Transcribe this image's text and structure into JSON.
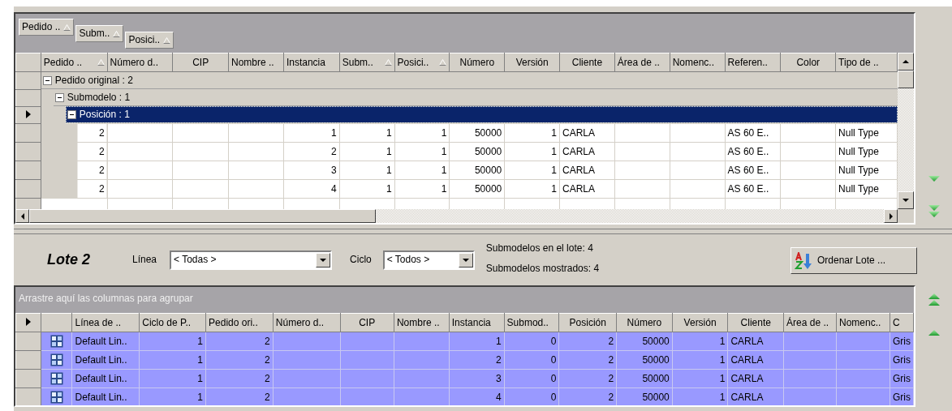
{
  "top_grid": {
    "group_by": [
      {
        "label": "Pedido ..",
        "sorted": true
      },
      {
        "label": "Subm..",
        "sorted": true
      },
      {
        "label": "Posici..",
        "sorted": true
      }
    ],
    "columns": [
      {
        "label": "Pedido ..",
        "sorted": true
      },
      {
        "label": "Número d.."
      },
      {
        "label": "CIP"
      },
      {
        "label": "Nombre .."
      },
      {
        "label": "Instancia"
      },
      {
        "label": "Subm..",
        "sorted": true
      },
      {
        "label": "Posici..",
        "sorted": true
      },
      {
        "label": "Número"
      },
      {
        "label": "Versión"
      },
      {
        "label": "Cliente"
      },
      {
        "label": "Área de .."
      },
      {
        "label": "Nomenc.."
      },
      {
        "label": "Referen.."
      },
      {
        "label": "Color"
      },
      {
        "label": "Tipo de .."
      }
    ],
    "groups": [
      {
        "label": "Pedido original : 2",
        "expanded": true,
        "selected": false,
        "children": [
          {
            "label": "Submodelo : 1",
            "expanded": true,
            "selected": false,
            "children": [
              {
                "label": "Posición : 1",
                "expanded": true,
                "selected": true,
                "rows": [
                  {
                    "cells": [
                      "2",
                      null,
                      null,
                      null,
                      "1",
                      "1",
                      "1",
                      "50000",
                      "1",
                      "CARLA",
                      null,
                      null,
                      "AS 60 E..",
                      null,
                      "Null Type"
                    ]
                  },
                  {
                    "cells": [
                      "2",
                      null,
                      null,
                      null,
                      "2",
                      "1",
                      "1",
                      "50000",
                      "1",
                      "CARLA",
                      null,
                      null,
                      "AS 60 E..",
                      null,
                      "Null Type"
                    ]
                  },
                  {
                    "cells": [
                      "2",
                      null,
                      null,
                      null,
                      "3",
                      "1",
                      "1",
                      "50000",
                      "1",
                      "CARLA",
                      null,
                      null,
                      "AS 60 E..",
                      null,
                      "Null Type"
                    ]
                  },
                  {
                    "cells": [
                      "2",
                      null,
                      null,
                      null,
                      "4",
                      "1",
                      "1",
                      "50000",
                      "1",
                      "CARLA",
                      null,
                      null,
                      "AS 60 E..",
                      null,
                      "Null Type"
                    ]
                  }
                ]
              }
            ]
          }
        ]
      }
    ]
  },
  "toolbar": {
    "title": "Lote 2",
    "line_label": "Línea",
    "line_value": "< Todas >",
    "cycle_label": "Ciclo",
    "cycle_value": "< Todos >",
    "info": [
      "Submodelos en el lote: 4",
      "Submodelos mostrados: 4"
    ],
    "sort_button": "Ordenar Lote ..."
  },
  "bottom_grid": {
    "group_placeholder": "Arrastre aquí las columnas para agrupar",
    "columns": [
      {
        "label": "Línea de .."
      },
      {
        "label": "Ciclo de P.."
      },
      {
        "label": "Pedido ori.."
      },
      {
        "label": "Número d.."
      },
      {
        "label": "CIP"
      },
      {
        "label": "Nombre .."
      },
      {
        "label": "Instancia"
      },
      {
        "label": "Submod.."
      },
      {
        "label": "Posición"
      },
      {
        "label": "Número"
      },
      {
        "label": "Versión"
      },
      {
        "label": "Cliente"
      },
      {
        "label": "Área de .."
      },
      {
        "label": "Nomenc.."
      },
      {
        "label": "C"
      }
    ],
    "rows": [
      {
        "selected": true,
        "cells": [
          "Default Lin..",
          "1",
          "2",
          null,
          null,
          null,
          "1",
          "0",
          "2",
          "50000",
          "1",
          "CARLA",
          null,
          null,
          "Gris"
        ]
      },
      {
        "selected": true,
        "cells": [
          "Default Lin..",
          "1",
          "2",
          null,
          null,
          null,
          "2",
          "0",
          "2",
          "50000",
          "1",
          "CARLA",
          null,
          null,
          "Gris"
        ]
      },
      {
        "selected": true,
        "cells": [
          "Default Lin..",
          "1",
          "2",
          null,
          null,
          null,
          "3",
          "0",
          "2",
          "50000",
          "1",
          "CARLA",
          null,
          null,
          "Gris"
        ]
      },
      {
        "selected": true,
        "cells": [
          "Default Lin..",
          "1",
          "2",
          null,
          null,
          null,
          "4",
          "0",
          "2",
          "50000",
          "1",
          "CARLA",
          null,
          null,
          "Gris"
        ]
      }
    ]
  }
}
